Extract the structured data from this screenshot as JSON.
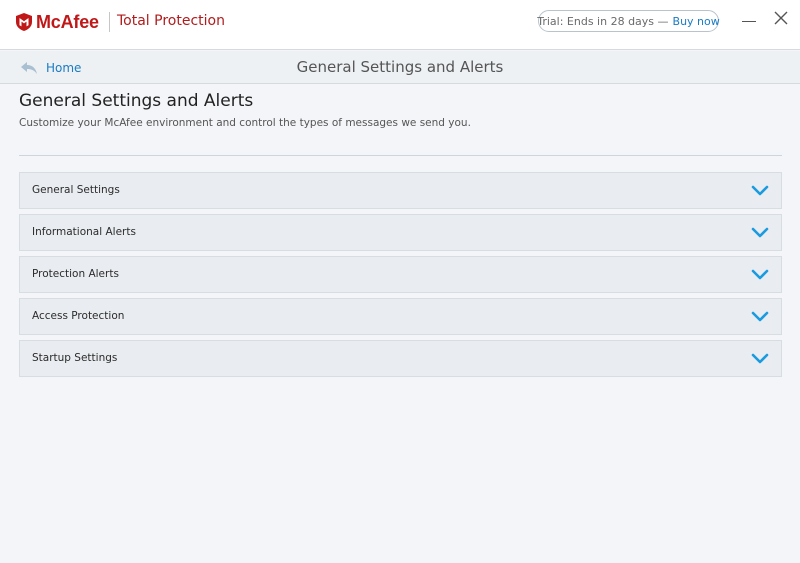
{
  "app": {
    "brand": "McAfee",
    "product": "Total Protection",
    "trial_text": "Trial: Ends in 28 days —",
    "buy_now": "Buy now"
  },
  "nav": {
    "home": "Home",
    "title": "General Settings and Alerts"
  },
  "page": {
    "heading": "General Settings and Alerts",
    "subtitle": "Customize your McAfee environment and control the types of messages we send you."
  },
  "sections": [
    {
      "label": "General Settings"
    },
    {
      "label": "Informational Alerts"
    },
    {
      "label": "Protection Alerts"
    },
    {
      "label": "Access Protection"
    },
    {
      "label": "Startup Settings"
    }
  ],
  "colors": {
    "brand_red": "#c01818",
    "accent_blue": "#1a9be0",
    "link_blue": "#1a7bc4"
  },
  "icons": {
    "shield": "mcafee-shield-icon",
    "back": "back-arrow-icon",
    "chevron": "chevron-down-icon",
    "minimize": "minimize-icon",
    "close": "close-icon"
  }
}
